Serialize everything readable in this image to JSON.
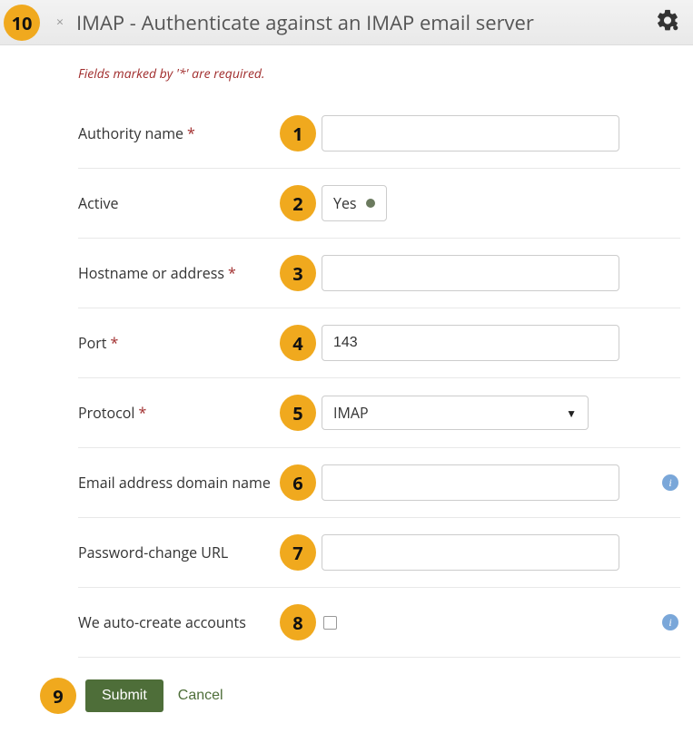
{
  "header": {
    "title": "IMAP - Authenticate against an IMAP email server",
    "close_x": "×"
  },
  "required_note": "Fields marked by '*' are required.",
  "steps": {
    "s1": "1",
    "s2": "2",
    "s3": "3",
    "s4": "4",
    "s5": "5",
    "s6": "6",
    "s7": "7",
    "s8": "8",
    "s9": "9",
    "s10": "10"
  },
  "fields": {
    "authority_name": {
      "label": "Authority name",
      "required": "*",
      "value": ""
    },
    "active": {
      "label": "Active",
      "value": "Yes"
    },
    "hostname": {
      "label": "Hostname or address",
      "required": "*",
      "value": ""
    },
    "port": {
      "label": "Port",
      "required": "*",
      "value": "143"
    },
    "protocol": {
      "label": "Protocol",
      "required": "*",
      "value": "IMAP"
    },
    "email_domain": {
      "label": "Email address domain name",
      "value": ""
    },
    "pwd_change_url": {
      "label": "Password-change URL",
      "value": ""
    },
    "auto_create": {
      "label": "We auto-create accounts",
      "checked": false
    }
  },
  "info_glyph": "i",
  "actions": {
    "submit": "Submit",
    "cancel": "Cancel"
  }
}
